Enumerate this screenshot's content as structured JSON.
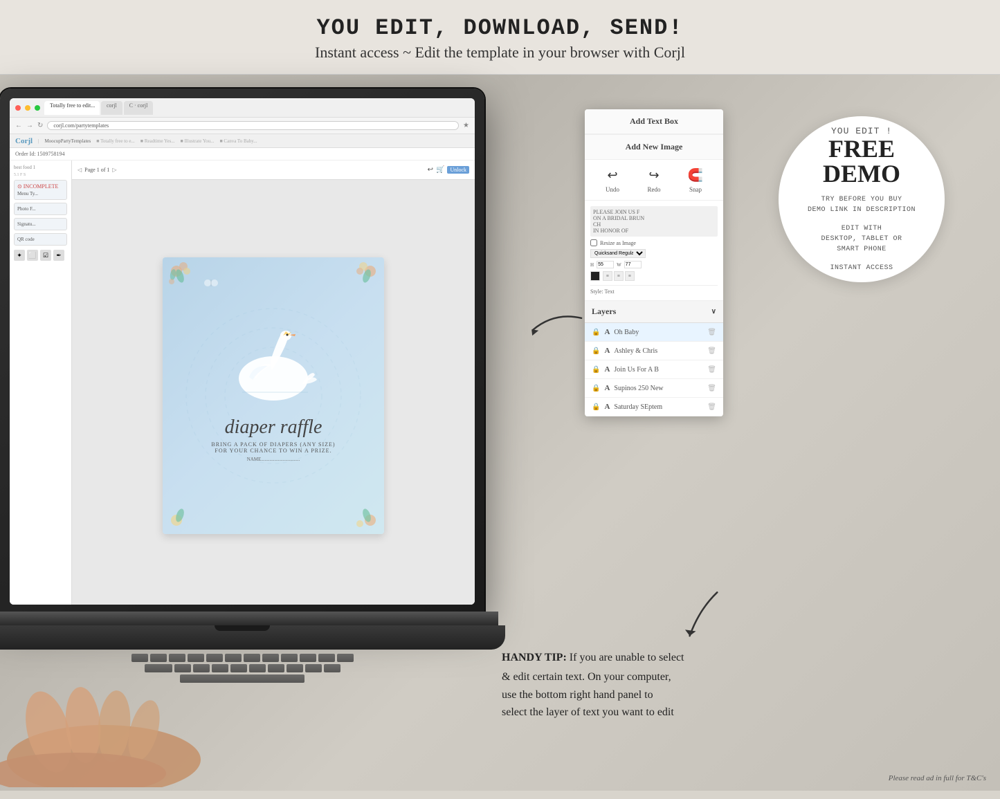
{
  "header": {
    "line1": "YOU EDIT, DOWNLOAD, SEND!",
    "line2": "Instant access ~ Edit the template in your browser with Corjl"
  },
  "browser": {
    "tabs": [
      "Totally free to edit...",
      "corjl",
      "C · corjl"
    ],
    "url": "corjl.com/partytemplates",
    "logo": "Corjl",
    "order_id": "Order Id: 1509758194"
  },
  "editor": {
    "side_items": [
      "Menu Ty...",
      "Photo F...",
      "Signatu...",
      "QR code"
    ]
  },
  "card": {
    "title": "diaper raffle",
    "subtitle": "BRING A PACK OF DIAPERS (ANY SIZE)\nFOR YOUR CHANCE TO WIN A PRIZE.",
    "name_line": "NAME................................"
  },
  "panel": {
    "add_text_box": "Add Text Box",
    "add_new_image": "Add New Image",
    "undo": "Undo",
    "redo": "Redo",
    "snap": "Snap",
    "style_text": "Style: Text",
    "layers_label": "Layers",
    "layers": [
      {
        "name": "Oh Baby",
        "type": "A",
        "locked": true,
        "highlighted": true
      },
      {
        "name": "Ashley & Chris",
        "type": "A",
        "locked": true,
        "highlighted": false
      },
      {
        "name": "Join Us For A B",
        "type": "A",
        "locked": true,
        "highlighted": false
      },
      {
        "name": "Supinos 250 New",
        "type": "A",
        "locked": true,
        "highlighted": false
      },
      {
        "name": "Saturday SEptem",
        "type": "A",
        "locked": true,
        "highlighted": false
      }
    ]
  },
  "demo_circle": {
    "you_edit": "YOU EDIT !",
    "free": "FREE",
    "demo": "DEMO",
    "line1": "TRY BEFORE YOU BUY",
    "line2": "DEMO LINK IN DESCRIPTION",
    "edit_label": "EDIT WITH",
    "devices": "DESKTOP, TABLET OR\nSMART PHONE",
    "access": "INSTANT ACCESS"
  },
  "tip": {
    "title": "HANDY TIP:",
    "body": "If you are unable to select\n& edit certain text. On your computer,\nuse the bottom right hand panel to\nselect the layer of text you want to edit"
  },
  "footer": {
    "tc": "Please read ad in full for T&C's"
  }
}
